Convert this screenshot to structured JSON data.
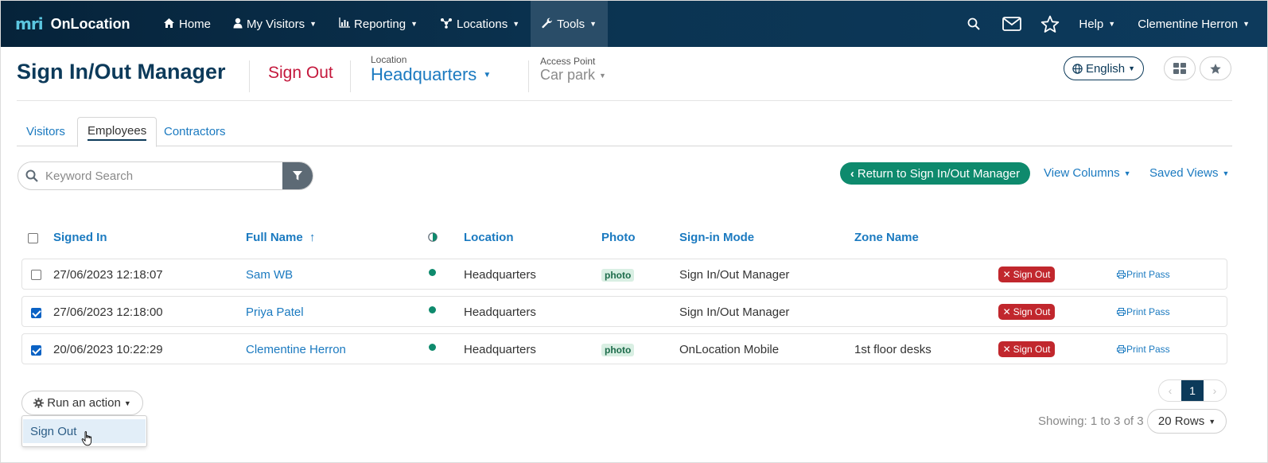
{
  "app": {
    "logo_text": "mri",
    "name": "OnLocation"
  },
  "nav": {
    "items": [
      {
        "label": "Home",
        "icon": "home-icon"
      },
      {
        "label": "My Visitors",
        "icon": "user-icon"
      },
      {
        "label": "Reporting",
        "icon": "bar-chart-icon"
      },
      {
        "label": "Locations",
        "icon": "network-icon"
      },
      {
        "label": "Tools",
        "icon": "wrench-icon"
      }
    ],
    "help_label": "Help",
    "user_name": "Clementine Herron"
  },
  "header": {
    "title": "Sign In/Out Manager",
    "sign_out_label": "Sign Out",
    "location_label": "Location",
    "location_value": "Headquarters",
    "access_point_label": "Access Point",
    "access_point_value": "Car park",
    "language": "English"
  },
  "tabs": [
    {
      "label": "Visitors"
    },
    {
      "label": "Employees",
      "active": true
    },
    {
      "label": "Contractors"
    }
  ],
  "search": {
    "placeholder": "Keyword Search"
  },
  "toolbar": {
    "return_label": "Return to Sign In/Out Manager",
    "view_columns_label": "View Columns",
    "saved_views_label": "Saved Views"
  },
  "table": {
    "columns": {
      "signed_in": "Signed In",
      "full_name": "Full Name",
      "sort_indicator": "↑",
      "location": "Location",
      "photo": "Photo",
      "sign_in_mode": "Sign-in Mode",
      "zone_name": "Zone Name"
    },
    "rows": [
      {
        "checked": false,
        "signed_in": "27/06/2023 12:18:07",
        "full_name": "Sam WB",
        "location": "Headquarters",
        "photo": "photo",
        "mode": "Sign In/Out Manager",
        "zone": "",
        "action": "Sign Out",
        "print": "Print Pass"
      },
      {
        "checked": true,
        "signed_in": "27/06/2023 12:18:00",
        "full_name": "Priya Patel",
        "location": "Headquarters",
        "photo": "",
        "mode": "Sign In/Out Manager",
        "zone": "",
        "action": "Sign Out",
        "print": "Print Pass"
      },
      {
        "checked": true,
        "signed_in": "20/06/2023 10:22:29",
        "full_name": "Clementine Herron",
        "location": "Headquarters",
        "photo": "photo",
        "mode": "OnLocation Mobile",
        "zone": "1st floor desks",
        "action": "Sign Out",
        "print": "Print Pass"
      }
    ]
  },
  "bottom": {
    "run_action_label": "Run an action",
    "dropdown_item": "Sign Out",
    "page_current": "1",
    "showing_text": "Showing: 1 to 3 of 3",
    "rows_label": "20 Rows"
  },
  "colors": {
    "navbar": "#0b3452",
    "primary_link": "#1b7ac0",
    "title": "#0c3a5a",
    "danger": "#c1272d",
    "success": "#0e8a6d"
  }
}
